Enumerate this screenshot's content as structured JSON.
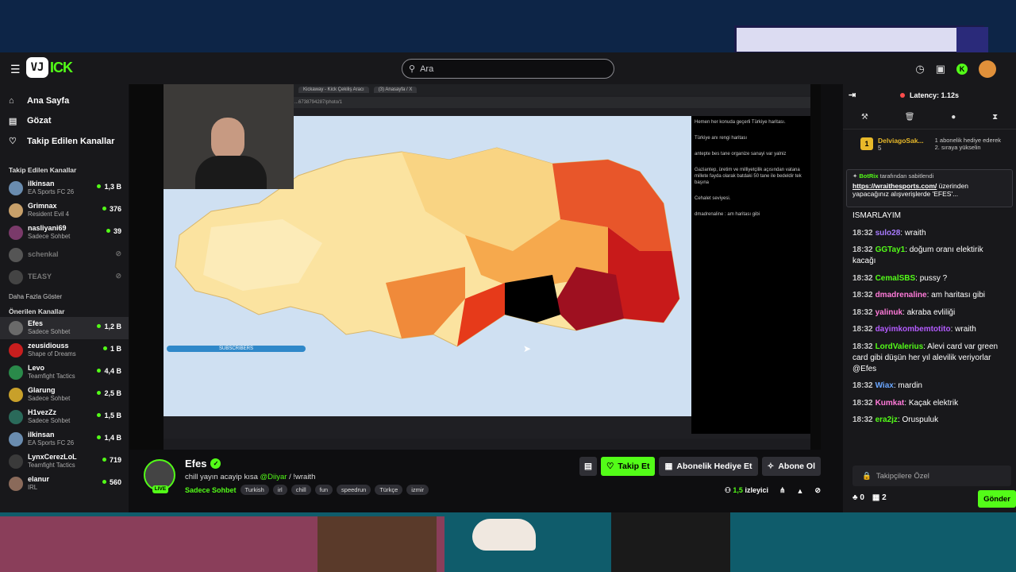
{
  "app": {
    "logo_text": "ICK",
    "logo_badge": "VJ",
    "search_placeholder": "Ara"
  },
  "nav": [
    {
      "label": "Ana Sayfa",
      "icon": "home-icon"
    },
    {
      "label": "Gözat",
      "icon": "browse-icon"
    },
    {
      "label": "Takip Edilen Kanallar",
      "icon": "heart-icon"
    }
  ],
  "sidebar": {
    "followed_title": "Takip Edilen Kanallar",
    "followed": [
      {
        "name": "ilkinsan",
        "sub": "EA Sports FC 26",
        "viewers": "1,3 B",
        "color": "#6a8caf"
      },
      {
        "name": "Grimnax",
        "sub": "Resident Evil 4",
        "viewers": "376",
        "color": "#c8a06a"
      },
      {
        "name": "nasliyani69",
        "sub": "Sadece Sohbet",
        "viewers": "39",
        "color": "#7a3a6a"
      },
      {
        "name": "schenkal",
        "sub": "",
        "viewers": "",
        "color": "#555"
      },
      {
        "name": "TEASY",
        "sub": "",
        "viewers": "",
        "color": "#444"
      }
    ],
    "more": "Daha Fazla Göster",
    "recommended_title": "Önerilen Kanallar",
    "recommended": [
      {
        "name": "Efes",
        "sub": "Sadece Sohbet",
        "viewers": "1,2 B",
        "color": "#6a6a6a"
      },
      {
        "name": "zeusidiouss",
        "sub": "Shape of Dreams",
        "viewers": "1 B",
        "color": "#c81e1e"
      },
      {
        "name": "Levo",
        "sub": "Teamfight Tactics",
        "viewers": "4,4 B",
        "color": "#2a8a4a"
      },
      {
        "name": "Glarung",
        "sub": "Sadece Sohbet",
        "viewers": "2,5 B",
        "color": "#c8a02a"
      },
      {
        "name": "H1vezZz",
        "sub": "Sadece Sohbet",
        "viewers": "1,5 B",
        "color": "#2a6a5a"
      },
      {
        "name": "ilkinsan",
        "sub": "EA Sports FC 26",
        "viewers": "1,4 B",
        "color": "#6a8caf"
      },
      {
        "name": "LynxCerezLoL",
        "sub": "Teamfight Tactics",
        "viewers": "719",
        "color": "#3a3a3a"
      },
      {
        "name": "elanur",
        "sub": "IRL",
        "viewers": "560",
        "color": "#8a6a5a"
      }
    ]
  },
  "stream": {
    "name": "Efes",
    "title_pre": "chill yayın acayip kısa ",
    "title_mention": "@Diiyar",
    "title_post": " / !wraith",
    "category": "Sadece Sohbet",
    "tags": [
      "Turkish",
      "irl",
      "chill",
      "fun",
      "speedrun",
      "Türkçe",
      "izmir"
    ],
    "live_label": "LIVE",
    "follow_label": "Takip Et",
    "gift_label": "Abonelik Hediye Et",
    "subscribe_label": "Abone Ol",
    "viewers_label": "izleyici",
    "viewers_count": "1,5"
  },
  "video": {
    "tabs": [
      "Kickaway - Kick Çekiliş Aracı",
      "(3) Anasayfa / X"
    ],
    "address": "...6738794287/photo/1",
    "subscribers_bar": "SUBSCRIBERS",
    "post_lines": [
      "Hemen her konuda geçerli Türkiye haritası.",
      "Türkiye anı rengi haritası",
      "antepte bes tane organize sanayi var yalniz",
      "Gaziantep, üretim ve milliyetçilik açısından vatana millete fayda olarak batdaki 50 tane ile bedeldir tek başına",
      "Cehalet seviyesi.",
      "dmadrenaline : am haritası gibi"
    ]
  },
  "chat": {
    "latency": "Latency: 1.12s",
    "gifter": {
      "name": "DelviagoSak...",
      "count": "5",
      "note": "1 abonelik hediye ederek 2. sıraya yükselin"
    },
    "pinned": {
      "user": "BotRix",
      "label": "tarafından sabitlendi",
      "link": "https://wraithesports.com/",
      "text": " üzerinden yapacağınız alışverişlerde 'EFES'..."
    },
    "messages": [
      {
        "time": "",
        "user": "",
        "color": "#fff",
        "text": "ISMARLAYIM"
      },
      {
        "time": "18:32",
        "user": "sulo28",
        "color": "#a87bff",
        "text": "wraith"
      },
      {
        "time": "18:32",
        "user": "GGTay1",
        "color": "#53fc18",
        "text": "doğum oranı elektirik kacağı"
      },
      {
        "time": "18:32",
        "user": "CemalSBS",
        "color": "#53fc18",
        "text": "pussy ?"
      },
      {
        "time": "18:32",
        "user": "dmadrenaline",
        "color": "#ff7ad9",
        "text": "am haritası gibi"
      },
      {
        "time": "18:32",
        "user": "yalinuk",
        "color": "#ff7ad9",
        "text": "akraba evliliği"
      },
      {
        "time": "18:32",
        "user": "dayimkombemtotito",
        "color": "#b45cff",
        "text": "wraith"
      },
      {
        "time": "18:32",
        "user": "LordValerius",
        "color": "#53fc18",
        "text": "Alevi card var green card gibi düşün her yıl alevilik veriyorlar @Efes"
      },
      {
        "time": "18:32",
        "user": "Wiax",
        "color": "#6aa6ff",
        "text": "mardin"
      },
      {
        "time": "18:32",
        "user": "Kumkat",
        "color": "#ff7ad9",
        "text": "Kaçak elektrik"
      },
      {
        "time": "18:32",
        "user": "era2jz",
        "color": "#53fc18",
        "text": "Oruspuluk"
      }
    ],
    "input_placeholder": "Takipçilere Özel",
    "stat_a": "0",
    "stat_b": "2",
    "send_label": "Gönder"
  }
}
